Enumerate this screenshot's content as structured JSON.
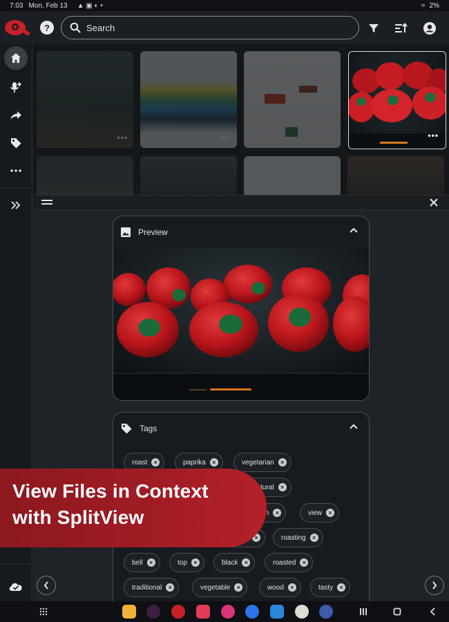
{
  "status": {
    "time": "7:03",
    "date": "Mon, Feb 13",
    "battery": "2%"
  },
  "search": {
    "placeholder": "Search"
  },
  "preview": {
    "title": "Preview"
  },
  "tags": {
    "title": "Tags",
    "items": [
      "roast",
      "paprika",
      "vegetarian",
      "natural",
      "autumn",
      "view",
      "roasting",
      "bell",
      "top",
      "black",
      "roasted",
      "traditional",
      "vegetable",
      "wood",
      "tasty"
    ]
  },
  "banner": {
    "line1": "View Files in Context",
    "line2": "with SplitView"
  },
  "colors": {
    "brand_red": "#c8202a",
    "banner_red": "#a51d26",
    "background": "#1f2328"
  },
  "icons": [
    "home-icon",
    "voice-add-icon",
    "share-icon",
    "tag-icon",
    "more-icon",
    "expand-icon",
    "filter-icon",
    "sort-icon",
    "account-icon",
    "cloud-sync-icon"
  ]
}
